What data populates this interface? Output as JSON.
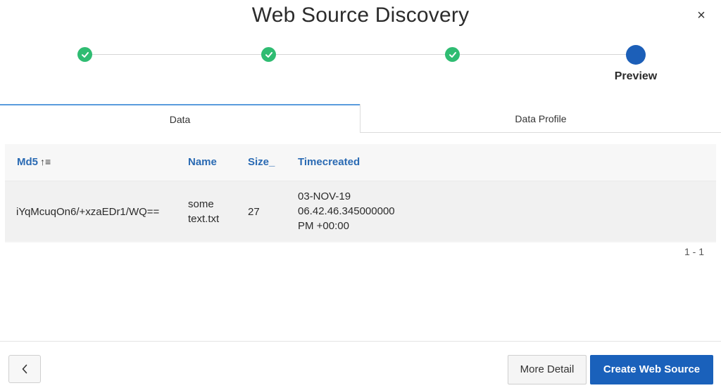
{
  "dialog": {
    "title": "Web Source Discovery",
    "close_glyph": "×"
  },
  "steps": {
    "items": [
      {
        "state": "completed",
        "icon": "check-icon"
      },
      {
        "state": "completed",
        "icon": "check-icon"
      },
      {
        "state": "completed",
        "icon": "check-icon"
      },
      {
        "state": "current",
        "label": "Preview"
      }
    ]
  },
  "tabs": [
    {
      "label": "Data",
      "active": true
    },
    {
      "label": "Data Profile",
      "active": false
    }
  ],
  "grid": {
    "columns": [
      {
        "label": "Md5",
        "sort_icon": "sort-ascending-icon",
        "sort_glyph": "↑≡"
      },
      {
        "label": "Name"
      },
      {
        "label": "Size_"
      },
      {
        "label": "Timecreated"
      }
    ],
    "rows": [
      {
        "md5": "iYqMcuqOn6/+xzaEDr1/WQ==",
        "name_line1": "some",
        "name_line2": "text.txt",
        "size": "27",
        "time_line1": "03-NOV-19",
        "time_line2": "06.42.46.345000000",
        "time_line3": "PM +00:00"
      }
    ],
    "pagination": "1 - 1"
  },
  "footer": {
    "back_icon": "chevron-left-icon",
    "more_detail_label": "More Detail",
    "create_label": "Create Web Source"
  },
  "colors": {
    "accent": "#1a61bb",
    "step_complete": "#2fbc72",
    "column_header": "#2a6ab3"
  }
}
